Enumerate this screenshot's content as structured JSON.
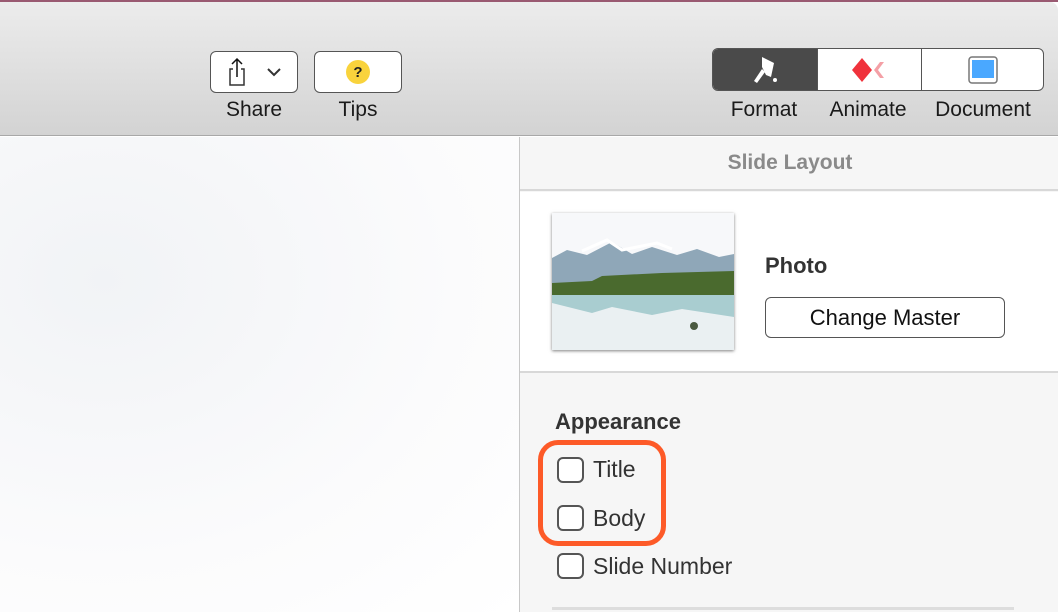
{
  "toolbar": {
    "share_label": "Share",
    "tips_label": "Tips",
    "tabs": [
      {
        "label": "Format",
        "icon": "paintbrush-icon",
        "active": true
      },
      {
        "label": "Animate",
        "icon": "animate-diamond-icon"
      },
      {
        "label": "Document",
        "icon": "document-icon"
      }
    ]
  },
  "panel": {
    "title": "Slide Layout",
    "master_name": "Photo",
    "change_master_label": "Change Master",
    "appearance": {
      "heading": "Appearance",
      "options": [
        {
          "label": "Title",
          "checked": false
        },
        {
          "label": "Body",
          "checked": false
        },
        {
          "label": "Slide Number",
          "checked": false
        }
      ]
    }
  },
  "colors": {
    "highlight": "#fd5a28",
    "active_tab": "#4a4a4a",
    "tips_icon": "#f9d33c",
    "animate_icon": "#f0323c"
  }
}
